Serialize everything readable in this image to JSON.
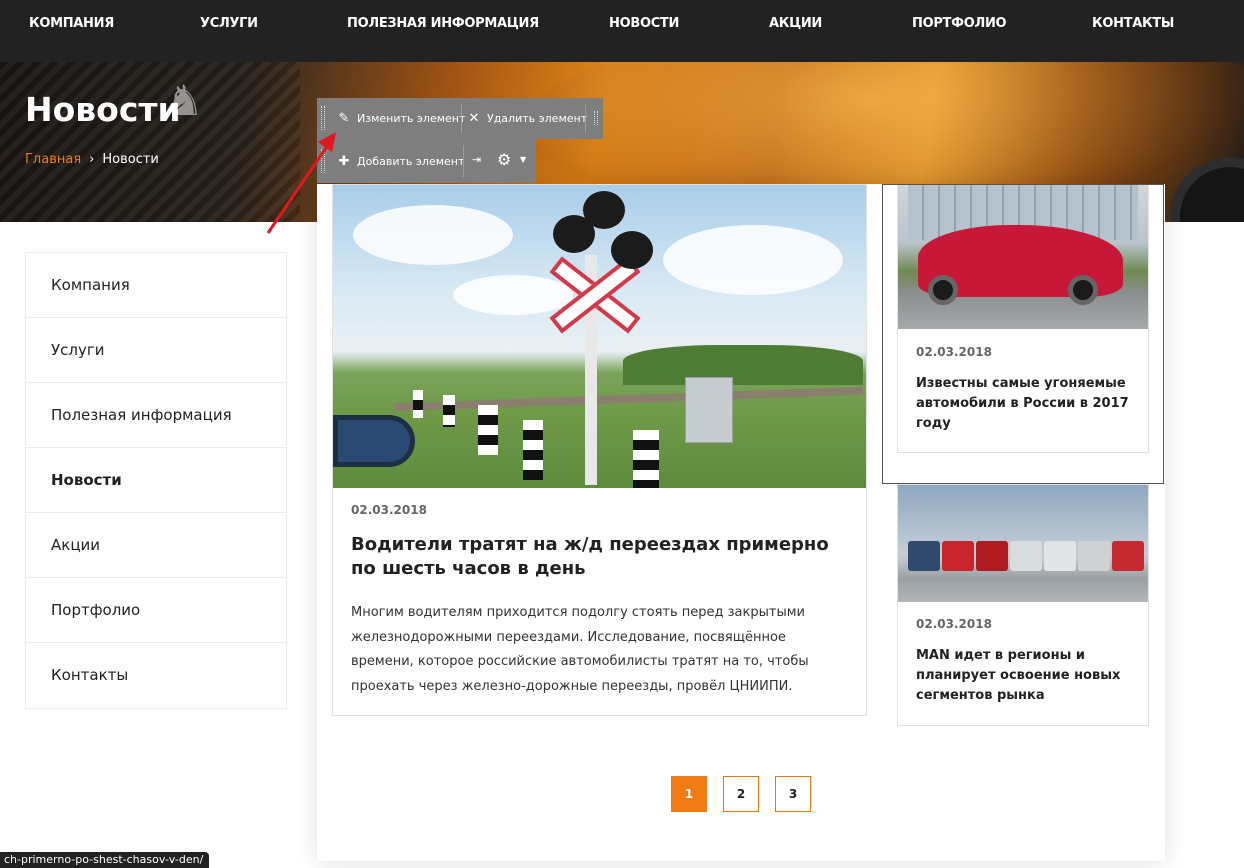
{
  "nav": {
    "items": [
      "Компания",
      "Услуги",
      "Полезная информация",
      "Новости",
      "Акции",
      "Портфолио",
      "Контакты"
    ]
  },
  "hero": {
    "title": "Новости",
    "breadcrumb_home": "Главная",
    "breadcrumb_sep": "›",
    "breadcrumb_current": "Новости"
  },
  "toolbar": {
    "edit_label": "Изменить элемент",
    "delete_label": "Удалить элемент",
    "add_label": "Добавить элемент"
  },
  "sidebar": {
    "items": [
      "Компания",
      "Услуги",
      "Полезная информация",
      "Новости",
      "Акции",
      "Портфолио",
      "Контакты"
    ],
    "active": "Новости"
  },
  "main_article": {
    "date": "02.03.2018",
    "title": "Водители тратят на ж/д переездах примерно по шесть часов в день",
    "text": "Многим водителям приходится подолгу стоять перед закрытыми железнодорожными переездами. Исследование, посвящённое времени, которое российские автомобилисты тратят на то, чтобы проехать через железно-дорожные переезды, провёл ЦНИИПИ."
  },
  "side_articles": [
    {
      "date": "02.03.2018",
      "title": "Известны самые угоняемые автомобили в России в 2017 году"
    },
    {
      "date": "02.03.2018",
      "title": "MAN идет в регионы и планирует освоение новых сегментов рынка"
    }
  ],
  "pagination": {
    "pages": [
      "1",
      "2",
      "3"
    ],
    "current": "1"
  },
  "status_url": "ch-primerno-po-shest-chasov-v-den/",
  "colors": {
    "accent": "#f07b12",
    "nav_bg": "#222222",
    "toolbar_bg": "#7e7e7e",
    "arrow": "#e0191e"
  }
}
